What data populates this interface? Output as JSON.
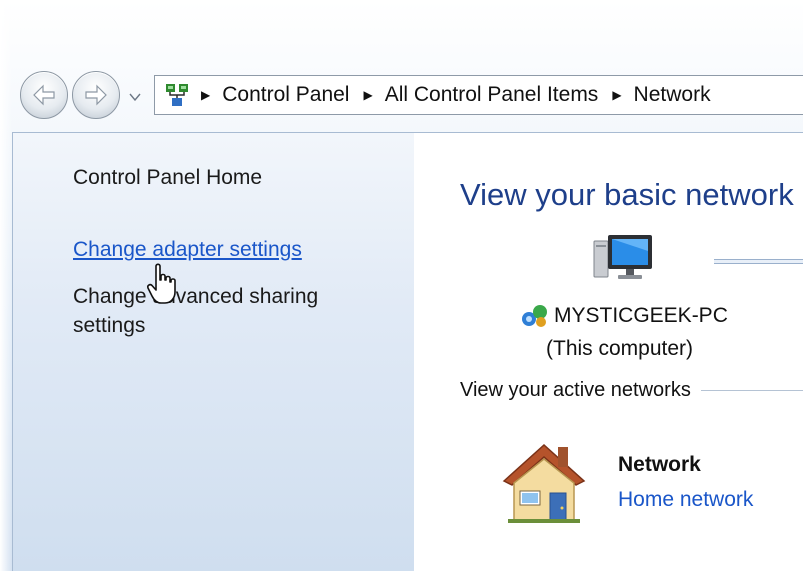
{
  "nav": {
    "back_icon": "back-arrow-icon",
    "forward_icon": "forward-arrow-icon",
    "history_icon": "dropdown-arrow-icon"
  },
  "address_bar": {
    "icon": "network-sharing-icon",
    "crumbs": [
      "Control Panel",
      "All Control Panel Items",
      "Network"
    ]
  },
  "sidebar": {
    "home_label": "Control Panel Home",
    "adapter_label": "Change adapter settings",
    "advanced_label": "Change advanced sharing settings"
  },
  "main": {
    "title": "View your basic network",
    "computer_name": "MYSTICGEEK-PC",
    "computer_sub": "(This computer)",
    "active_networks_label": "View your active networks",
    "network_name": "Network",
    "network_type": "Home network"
  },
  "colors": {
    "link": "#1a56c9",
    "title": "#1e3f8a"
  }
}
